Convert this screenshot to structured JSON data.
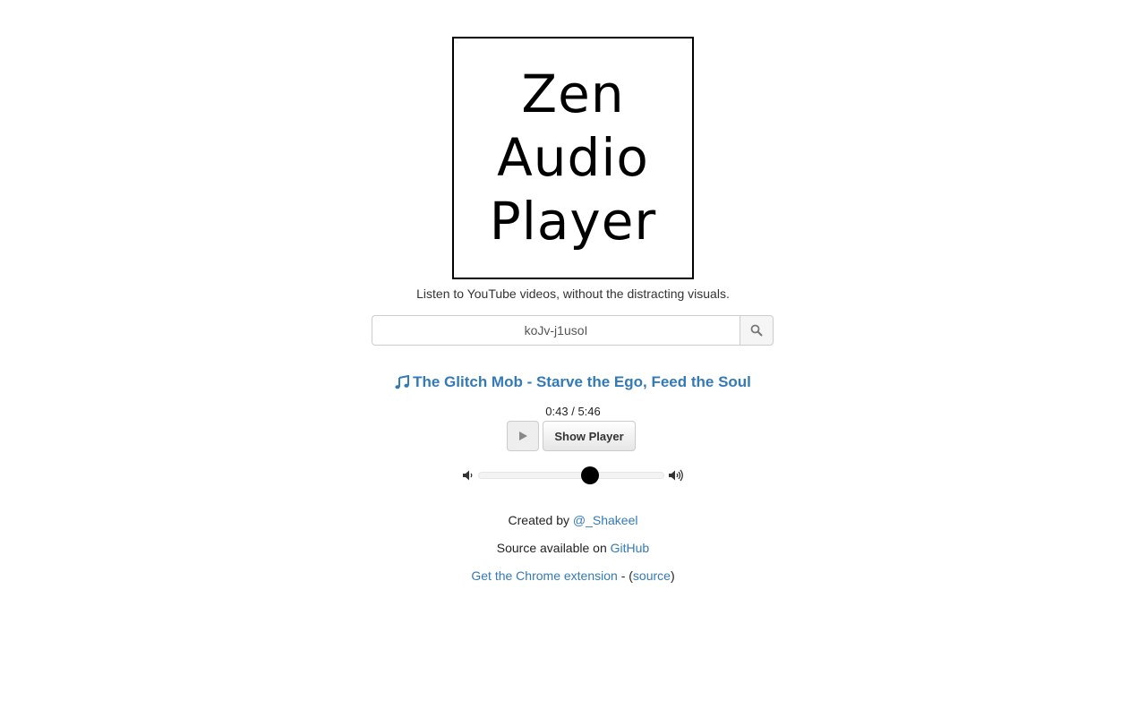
{
  "logo": {
    "lines": [
      "Zen",
      "Audio",
      "Player"
    ]
  },
  "tagline": "Listen to YouTube videos, without the distracting visuals.",
  "search": {
    "value": "koJv-j1usoI",
    "icon": "search-icon"
  },
  "song": {
    "icon": "music-note-icon",
    "title": "The Glitch Mob - Starve the Ego, Feed the Soul"
  },
  "player": {
    "current_time": "0:43",
    "separator": "/",
    "duration": "5:46",
    "play_icon": "play-icon",
    "show_player_label": "Show Player",
    "volume_fraction": 0.6
  },
  "footer": {
    "created_by_text": "Created by",
    "created_by_link": "@_Shakeel",
    "source_text": "Source available on",
    "source_link": "GitHub",
    "extension_link": "Get the Chrome extension",
    "extension_dash": "- (",
    "extension_source_link": "source",
    "extension_close": ")"
  },
  "colors": {
    "link": "#337ab7",
    "text": "#333333",
    "border": "#cccccc"
  }
}
